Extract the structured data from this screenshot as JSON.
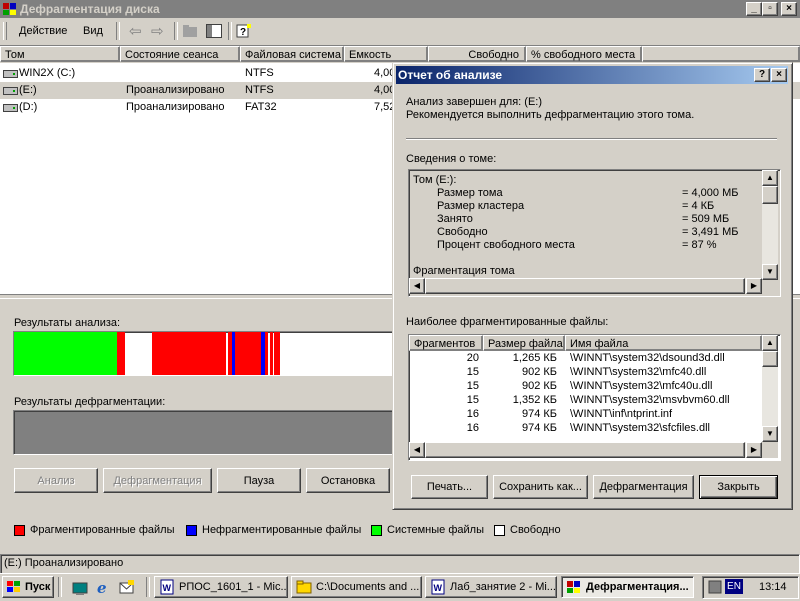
{
  "window": {
    "title": "Дефрагментация диска"
  },
  "menu": {
    "action": "Действие",
    "view": "Вид"
  },
  "columns": [
    "Том",
    "Состояние сеанса",
    "Файловая система",
    "Емкость",
    "Свободно",
    "% свободного места"
  ],
  "volumes": [
    {
      "name": "WIN2X (C:)",
      "status": "",
      "fs": "NTFS",
      "capacity": "4,00"
    },
    {
      "name": "(E:)",
      "status": "Проанализировано",
      "fs": "NTFS",
      "capacity": "4,00"
    },
    {
      "name": "(D:)",
      "status": "Проанализировано",
      "fs": "FAT32",
      "capacity": "7,52"
    }
  ],
  "analysis_label": "Результаты анализа:",
  "defrag_label": "Результаты дефрагментации:",
  "buttons": {
    "analyze": "Анализ",
    "defrag": "Дефрагментация",
    "pause": "Пауза",
    "stop": "Остановка"
  },
  "legend": {
    "fragmented": "Фрагментированные файлы",
    "contiguous": "Нефрагментированные файлы",
    "system": "Системные файлы",
    "free": "Свободно"
  },
  "colors": {
    "fragmented": "#ff0000",
    "contiguous": "#0000ff",
    "system": "#00ff00",
    "free": "#ffffff"
  },
  "statusbar": "(E:) Проанализировано",
  "dialog": {
    "title": "Отчет об анализе",
    "line1": "Анализ завершен для: (E:)",
    "line2": "Рекомендуется выполнить дефрагментацию этого тома.",
    "volume_info_label": "Сведения о томе:",
    "volume_heading": "Том (E:):",
    "stats": [
      {
        "k": "Размер тома",
        "v": "= 4,000 МБ"
      },
      {
        "k": "Размер кластера",
        "v": "= 4 КБ"
      },
      {
        "k": "Занято",
        "v": "= 509 МБ"
      },
      {
        "k": "Свободно",
        "v": "= 3,491 МБ"
      },
      {
        "k": "Процент свободного места",
        "v": "= 87 %"
      }
    ],
    "frag_heading": "Фрагментация тома",
    "files_label": "Наиболее фрагментированные файлы:",
    "file_columns": [
      "Фрагментов",
      "Размер файла",
      "Имя файла"
    ],
    "files": [
      {
        "frags": "20",
        "size": "1,265 КБ",
        "name": "\\WINNT\\system32\\dsound3d.dll"
      },
      {
        "frags": "15",
        "size": "902 КБ",
        "name": "\\WINNT\\system32\\mfc40.dll"
      },
      {
        "frags": "15",
        "size": "902 КБ",
        "name": "\\WINNT\\system32\\mfc40u.dll"
      },
      {
        "frags": "15",
        "size": "1,352 КБ",
        "name": "\\WINNT\\system32\\msvbvm60.dll"
      },
      {
        "frags": "16",
        "size": "974 КБ",
        "name": "\\WINNT\\inf\\ntprint.inf"
      },
      {
        "frags": "16",
        "size": "974 КБ",
        "name": "\\WINNT\\system32\\sfcfiles.dll"
      }
    ],
    "btn_print": "Печать...",
    "btn_save": "Сохранить как...",
    "btn_defrag": "Дефрагментация",
    "btn_close": "Закрыть"
  },
  "taskbar": {
    "start": "Пуск",
    "tasks": [
      "РПОС_1601_1 - Mic...",
      "C:\\Documents and ...",
      "Лаб_занятие 2 - Mi...",
      "Дефрагментация..."
    ],
    "lang": "EN",
    "clock": "13:14"
  }
}
